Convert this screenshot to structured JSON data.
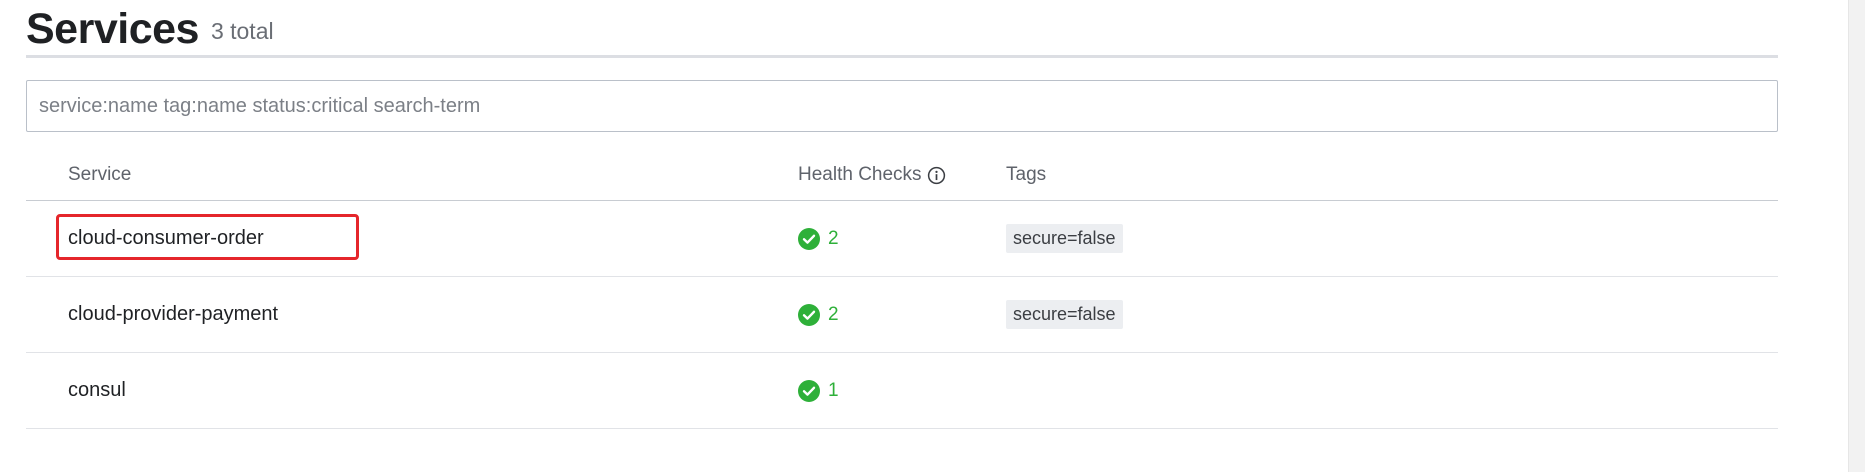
{
  "header": {
    "title": "Services",
    "count": "3 total"
  },
  "search": {
    "placeholder": "service:name tag:name status:critical search-term",
    "value": ""
  },
  "table": {
    "columns": {
      "service": "Service",
      "health": "Health Checks",
      "tags": "Tags"
    },
    "rows": [
      {
        "name": "cloud-consumer-order",
        "checks": "2",
        "tag": "secure=false"
      },
      {
        "name": "cloud-provider-payment",
        "checks": "2",
        "tag": "secure=false"
      },
      {
        "name": "consul",
        "checks": "1",
        "tag": ""
      }
    ]
  },
  "colors": {
    "passing": "#2eb039",
    "highlight": "#e5262b"
  },
  "icons": {
    "info": "info-circle-icon",
    "passing": "check-circle-icon"
  }
}
